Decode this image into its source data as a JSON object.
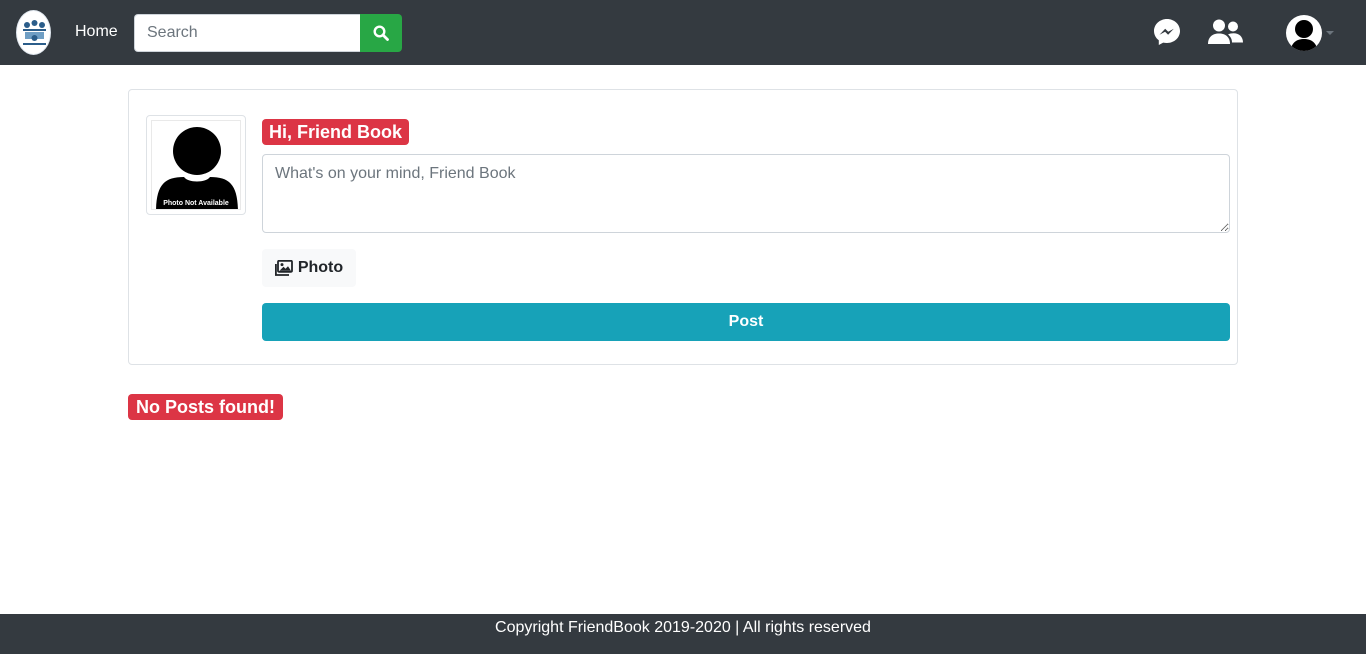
{
  "navbar": {
    "home_label": "Home",
    "search_placeholder": "Search",
    "search_icon": "search-icon",
    "messenger_icon": "messenger-icon",
    "friends_icon": "friends-icon",
    "profile_icon": "user-avatar",
    "bg_color": "#343a40"
  },
  "composer": {
    "greeting": "Hi, Friend Book",
    "textarea_placeholder": "What's on your mind, Friend Book",
    "avatar_caption": "Photo Not Available",
    "photo_button_label": "Photo",
    "post_button_label": "Post",
    "post_button_color": "#17a2b8",
    "badge_color": "#dc3545"
  },
  "feed": {
    "empty_message": "No Posts found!"
  },
  "footer": {
    "text": "Copyright FriendBook 2019-2020 | All rights reserved"
  }
}
